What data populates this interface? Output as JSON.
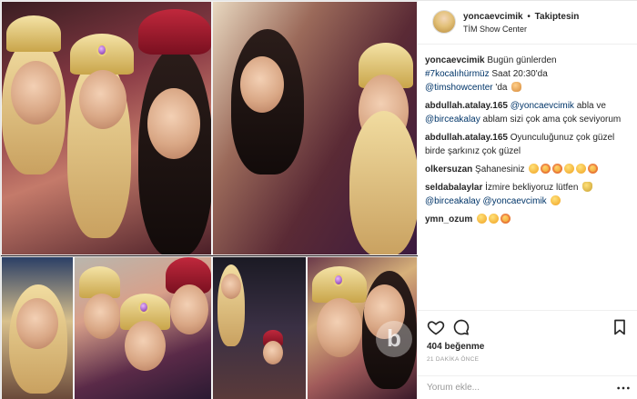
{
  "post": {
    "username": "yoncaevcimik",
    "follow_label": "Takiptesin",
    "location": "TİM Show Center"
  },
  "comments": [
    {
      "user": "yoncaevcimik",
      "text_before": "Bugün günlerden ",
      "hashtag": "#7kocalıhürmüz",
      "text_mid": " Saat 20:30'da ",
      "mention": "@timshowcenter",
      "text_after": " 'da"
    },
    {
      "user": "abdullah.atalay.165",
      "mention": "@yoncaevcimik",
      "text_mid": " abla ve ",
      "mention2": "@birceakalay",
      "text_after": " ablam sizi çok ama çok seviyorum"
    },
    {
      "user": "abdullah.atalay.165",
      "text_after": " Oyunculuğunuz çok güzel birde şarkınız çok güzel"
    },
    {
      "user": "olkersuzan",
      "text_after": " Şahanesiniz"
    },
    {
      "user": "seldabalaylar",
      "text_before": " İzmire bekliyoruz lütfen ",
      "mention": "@birceakalay",
      "mention2": "@yoncaevcimik"
    },
    {
      "user": "ymn_ozum"
    }
  ],
  "actions": {
    "likes": "404 beğenme",
    "time": "21 DAKİKA ÖNCE"
  },
  "add_comment": {
    "placeholder": "Yorum ekle..."
  },
  "icons": {
    "like": "heart-icon",
    "comment": "comment-icon",
    "save": "bookmark-icon",
    "more": "more-options-icon"
  }
}
